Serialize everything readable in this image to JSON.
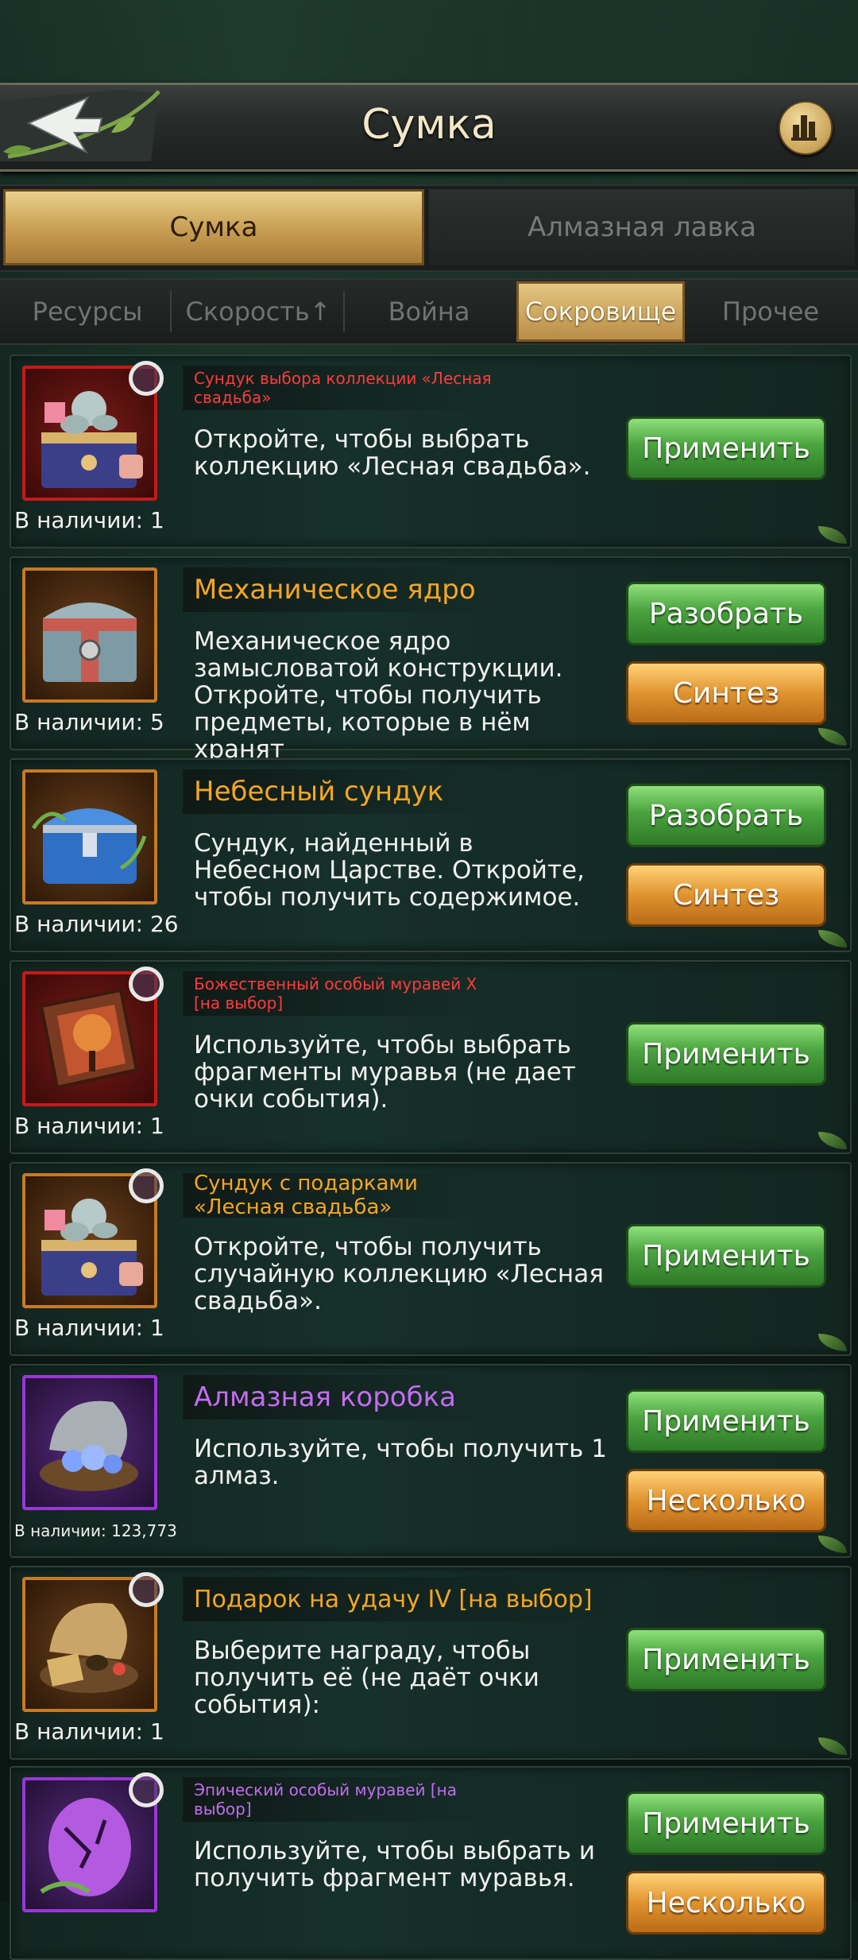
{
  "header": {
    "title": "Сумка"
  },
  "main_tabs": [
    {
      "label": "Сумка",
      "active": true
    },
    {
      "label": "Алмазная лавка",
      "active": false
    }
  ],
  "sub_tabs": [
    {
      "label": "Ресурсы",
      "active": false
    },
    {
      "label": "Скорость↑",
      "active": false
    },
    {
      "label": "Война",
      "active": false
    },
    {
      "label": "Сокровище",
      "active": true
    },
    {
      "label": "Прочее",
      "active": false
    }
  ],
  "items": [
    {
      "name": "Сундук выбора коллекции «Лесная свадьба»",
      "name_color": "#ff3b3b",
      "description": "Откройте, чтобы выбрать коллекцию «Лесная свадьба».",
      "count": "В наличии: 1",
      "buttons": [
        "Применить"
      ],
      "rarity": "red",
      "icon": "cupid-chest-icon"
    },
    {
      "name": "Механическое ядро",
      "name_color": "#f5a623",
      "description": "Механическое ядро замысловатой конструкции. Откройте, чтобы получить предметы, которые в нём хранят",
      "count": "В наличии: 5",
      "buttons": [
        "Разобрать",
        "Синтез"
      ],
      "rarity": "orange",
      "icon": "mechanical-chest-icon"
    },
    {
      "name": "Небесный сундук",
      "name_color": "#f5a623",
      "description": "Сундук, найденный в Небесном Царстве. Откройте, чтобы получить содержимое.",
      "count": "В наличии: 26",
      "buttons": [
        "Разобрать",
        "Синтез"
      ],
      "rarity": "orange",
      "icon": "celestial-chest-icon"
    },
    {
      "name": "Божественный особый муравей X [на выбор]",
      "name_color": "#ff3b3b",
      "description": "Используйте, чтобы выбрать фрагменты муравья (не дает очки события).",
      "count": "В наличии: 1",
      "buttons": [
        "Применить"
      ],
      "rarity": "red",
      "icon": "divine-ant-icon"
    },
    {
      "name": "Сундук с подарками «Лесная свадьба»",
      "name_color": "#f5a623",
      "description": "Откройте, чтобы получить случайную коллекцию «Лесная свадьба».",
      "count": "В наличии: 1",
      "buttons": [
        "Применить"
      ],
      "rarity": "orange",
      "icon": "gift-chest-icon"
    },
    {
      "name": "Алмазная коробка",
      "name_color": "#c36cf0",
      "description": "Используйте, чтобы получить 1 алмаз.",
      "count": "В наличии: 123,773",
      "buttons": [
        "Применить",
        "Несколько"
      ],
      "rarity": "purple",
      "icon": "diamond-shell-icon"
    },
    {
      "name": "Подарок на удачу IV [на выбор]",
      "name_color": "#f5a623",
      "description": "Выберите награду, чтобы получить её (не даёт очки события):",
      "count": "В наличии: 1",
      "buttons": [
        "Применить"
      ],
      "rarity": "orange",
      "icon": "lucky-gift-icon"
    },
    {
      "name": "Эпический особый муравей [на выбор]",
      "name_color": "#c36cf0",
      "description": "Используйте, чтобы выбрать и получить фрагмент муравья.",
      "count": "",
      "buttons": [
        "Применить",
        "Несколько"
      ],
      "rarity": "purple",
      "icon": "epic-ant-egg-icon"
    }
  ]
}
